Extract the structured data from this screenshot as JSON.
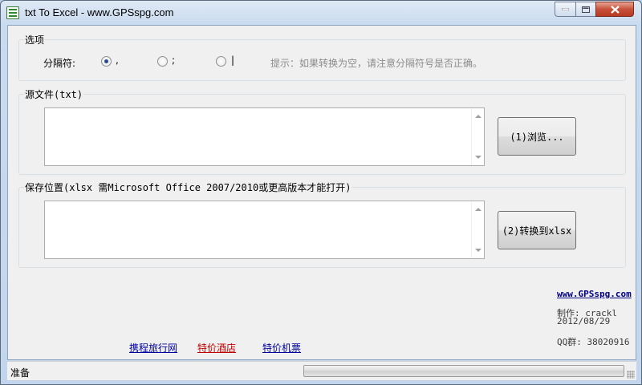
{
  "window": {
    "title": "txt To Excel - www.GPSspg.com"
  },
  "options": {
    "group_label": "选项",
    "delimiter_label": "分隔符:",
    "delimiters": [
      {
        "symbol": ",",
        "selected": true
      },
      {
        "symbol": ";",
        "selected": false
      },
      {
        "symbol": "|",
        "selected": false
      }
    ],
    "hint": "提示：如果转换为空，请注意分隔符号是否正确。"
  },
  "source": {
    "group_label": "源文件(txt)",
    "path_value": "",
    "browse_button": "(1)浏览..."
  },
  "save": {
    "group_label": "保存位置(xlsx 需Microsoft Office 2007/2010或更高版本才能打开)",
    "path_value": "",
    "convert_button": "(2)转换到xlsx"
  },
  "footer": {
    "links": [
      {
        "label": "携程旅行网",
        "color": "#0000a0"
      },
      {
        "label": "特价酒店",
        "color": "#c00000"
      },
      {
        "label": "特价机票",
        "color": "#0000a0"
      }
    ],
    "site_link": "www.GPSspg.com",
    "author_line": "制作: crackl",
    "date_line": "2012/08/29",
    "qq_line": "QQ群: 38020916"
  },
  "status": {
    "text": "准备",
    "progress": 0
  },
  "colors": {
    "link_blue": "#0000a0",
    "link_red": "#c00000",
    "close_button": "#c7503a"
  }
}
